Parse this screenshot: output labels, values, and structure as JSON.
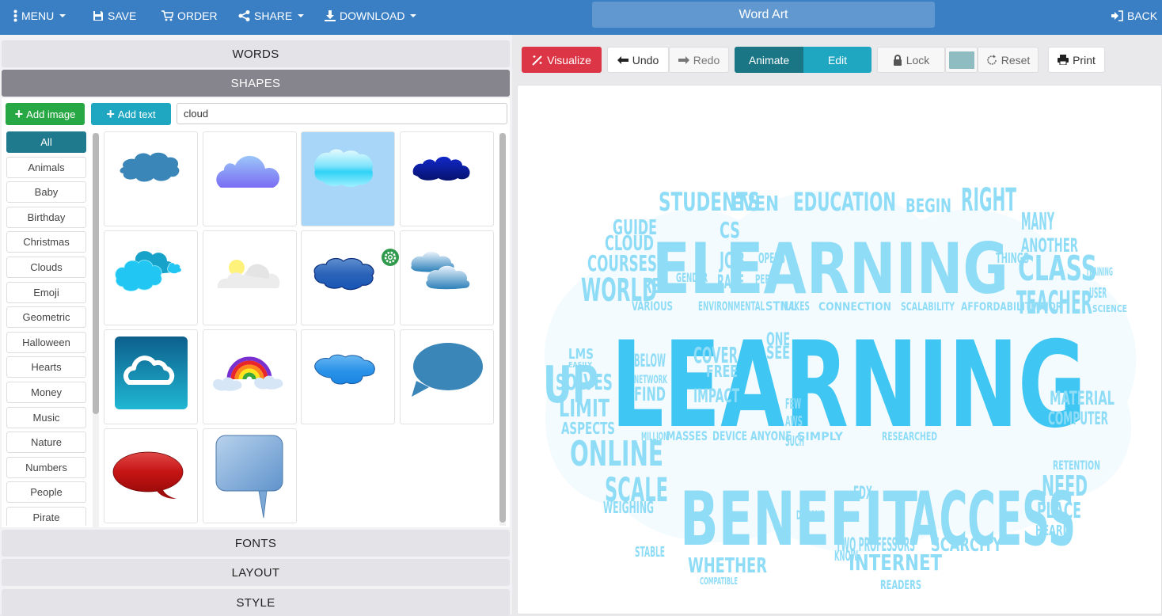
{
  "topbar": {
    "menu": "MENU",
    "save": "SAVE",
    "order": "ORDER",
    "share": "SHARE",
    "download": "DOWNLOAD",
    "title": "Word Art",
    "back": "BACK"
  },
  "left": {
    "sections": {
      "words": "WORDS",
      "shapes": "SHAPES",
      "fonts": "FONTS",
      "layout": "LAYOUT",
      "style": "STYLE"
    },
    "add_image": "Add image",
    "add_text": "Add text",
    "search_value": "cloud",
    "categories": [
      "All",
      "Animals",
      "Baby",
      "Birthday",
      "Christmas",
      "Clouds",
      "Emoji",
      "Geometric",
      "Halloween",
      "Hearts",
      "Money",
      "Music",
      "Nature",
      "Numbers",
      "People",
      "Pirate"
    ],
    "active_category": "All",
    "shapes": [
      {
        "name": "cloud-flat-steelblue",
        "selected": false
      },
      {
        "name": "cloud-gradient-violet",
        "selected": false
      },
      {
        "name": "cloud-glossy-cyan",
        "selected": true
      },
      {
        "name": "cloud-dark-navy",
        "selected": false
      },
      {
        "name": "cloud-cluster-cyan",
        "selected": false
      },
      {
        "name": "cloud-sun-gray",
        "selected": false
      },
      {
        "name": "cloud-glossy-blue",
        "selected": false
      },
      {
        "name": "cloud-double-blue",
        "selected": false
      },
      {
        "name": "cloud-icon-tile",
        "selected": false
      },
      {
        "name": "rainbow-clouds",
        "selected": false
      },
      {
        "name": "cloud-bright-blue",
        "selected": false
      },
      {
        "name": "speech-bubble-blue",
        "selected": false
      },
      {
        "name": "speech-bubble-red",
        "selected": false
      },
      {
        "name": "speech-bubble-square",
        "selected": false
      }
    ]
  },
  "toolbar": {
    "visualize": "Visualize",
    "undo": "Undo",
    "redo": "Redo",
    "animate": "Animate",
    "edit": "Edit",
    "lock": "Lock",
    "reset": "Reset",
    "print": "Print",
    "color_swatch": "#8fbcc0"
  },
  "colors": {
    "topbar": "#3a7fc4",
    "visualize": "#dc3545",
    "animate": "#1a7585",
    "edit": "#1fa7c2",
    "add_image": "#28a745",
    "add_text": "#1fa7c2",
    "word_strong": "#3fc6f2",
    "word_light": "#8fdcf7"
  },
  "wordcloud": {
    "words": [
      {
        "t": "LEARNING",
        "big": true
      },
      {
        "t": "ELEARNING",
        "big": true
      },
      {
        "t": "BENEFIT",
        "big": true
      },
      {
        "t": "ACCESS",
        "big": true
      },
      {
        "t": "STUDENTS"
      },
      {
        "t": "EVEN"
      },
      {
        "t": "EDUCATION"
      },
      {
        "t": "RIGHT"
      },
      {
        "t": "BEGIN"
      },
      {
        "t": "GUIDE"
      },
      {
        "t": "CLOUD"
      },
      {
        "t": "COURSES"
      },
      {
        "t": "WORLD"
      },
      {
        "t": "RE"
      },
      {
        "t": "CS"
      },
      {
        "t": "JOB"
      },
      {
        "t": "RACE"
      },
      {
        "t": "GENDER"
      },
      {
        "t": "OPENS"
      },
      {
        "t": "PERSON"
      },
      {
        "t": "MANY"
      },
      {
        "t": "ANOTHER"
      },
      {
        "t": "THINGS"
      },
      {
        "t": "CLASS"
      },
      {
        "t": "TEACHER"
      },
      {
        "t": "TRAINING"
      },
      {
        "t": "USER"
      },
      {
        "t": "SCIENCE"
      },
      {
        "t": "VARIOUS"
      },
      {
        "t": "ENVIRONMENTAL"
      },
      {
        "t": "STILL"
      },
      {
        "t": "MAKES"
      },
      {
        "t": "CONNECTION"
      },
      {
        "t": "SCALABILITY"
      },
      {
        "t": "AFFORDABILITY"
      },
      {
        "t": "MAJOR"
      },
      {
        "t": "UP"
      },
      {
        "t": "LMS"
      },
      {
        "t": "EASILY"
      },
      {
        "t": "BELOW"
      },
      {
        "t": "NETWORK"
      },
      {
        "t": "FIND"
      },
      {
        "t": "COVER"
      },
      {
        "t": "FREE"
      },
      {
        "t": "IMPACT"
      },
      {
        "t": "ONE"
      },
      {
        "t": "SEE"
      },
      {
        "t": "SOLVES"
      },
      {
        "t": "LIMIT"
      },
      {
        "t": "ASPECTS"
      },
      {
        "t": "ONLINE"
      },
      {
        "t": "SCALE"
      },
      {
        "t": "WEIGHING"
      },
      {
        "t": "MILLION"
      },
      {
        "t": "MASSES"
      },
      {
        "t": "DEVICE"
      },
      {
        "t": "ANYONE"
      },
      {
        "t": "SIMPLY"
      },
      {
        "t": "RESEARCHED"
      },
      {
        "t": "MATERIAL"
      },
      {
        "t": "COMPUTER"
      },
      {
        "t": "RETENTION"
      },
      {
        "t": "NEED"
      },
      {
        "t": "PLACE"
      },
      {
        "t": "HEARD"
      },
      {
        "t": "SCARCITY"
      },
      {
        "t": "TWO PROFESSORS"
      },
      {
        "t": "INTERNET"
      },
      {
        "t": "WHETHER"
      },
      {
        "t": "STABLE"
      },
      {
        "t": "COMPATIBLE"
      },
      {
        "t": "EDX"
      },
      {
        "t": "KNOW"
      },
      {
        "t": "READERS"
      },
      {
        "t": "DEMAND"
      },
      {
        "t": "FEW"
      },
      {
        "t": "AWS"
      },
      {
        "t": "SUCH"
      }
    ]
  }
}
